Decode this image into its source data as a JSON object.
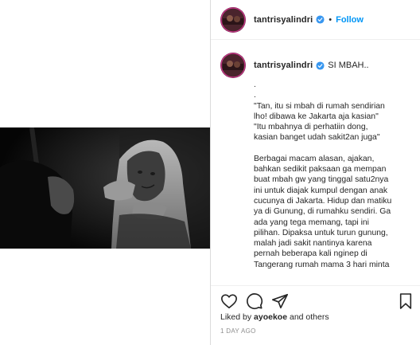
{
  "post": {
    "username": "tantrisyalindri",
    "follow_label": "Follow",
    "separator": "•",
    "caption_title": "SI MBAH..",
    "caption_lines": [
      ".",
      ".",
      "\"Tan, itu si mbah di rumah sendirian",
      "lho! dibawa ke Jakarta aja kasian\"",
      "\"Itu mbahnya di perhatiin dong,",
      "kasian banget udah sakit2an juga\"",
      "",
      "Berbagai macam alasan, ajakan,",
      "bahkan sedikit paksaan ga mempan",
      "buat mbah gw yang tinggal satu2nya",
      "ini untuk diajak kumpul dengan anak",
      "cucunya di Jakarta. Hidup dan matiku",
      "ya di Gunung, di rumahku sendiri. Ga",
      "ada yang tega memang, tapi ini",
      "pilihan. Dipaksa untuk turun gunung,",
      "malah jadi sakit nantinya karena",
      "pernah beberapa kali nginep di",
      "Tangerang rumah mama 3 hari minta"
    ],
    "likes_prefix": "Liked by ",
    "liked_by": "ayoekoe",
    "likes_suffix": " and others",
    "timestamp": "1 DAY AGO"
  },
  "icons": {
    "verified": "verified-badge-icon",
    "like": "heart-icon",
    "comment": "comment-icon",
    "share": "send-icon",
    "save": "bookmark-icon"
  },
  "colors": {
    "follow": "#0095f6",
    "verified": "#3897f0",
    "text": "#262626",
    "muted": "#8e8e8e"
  }
}
